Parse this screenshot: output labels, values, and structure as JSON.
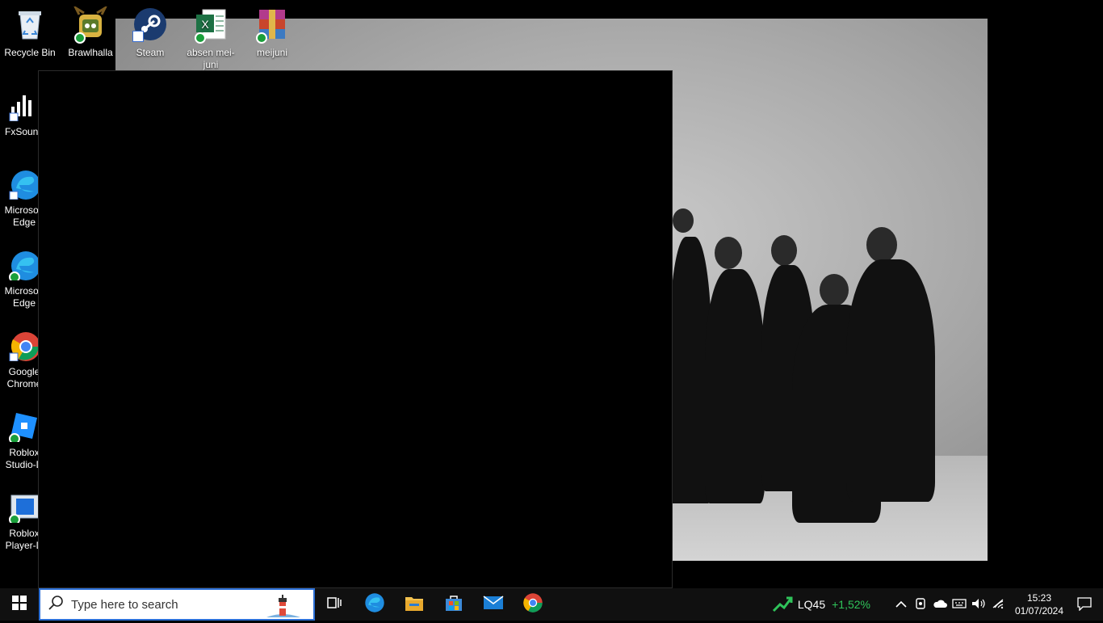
{
  "desktop": {
    "top_icons": [
      {
        "label": "Recycle Bin",
        "icon": "recycle-bin-icon"
      },
      {
        "label": "Brawlhalla",
        "icon": "brawlhalla-icon"
      },
      {
        "label": "Steam",
        "icon": "steam-icon"
      },
      {
        "label": "absen mei-juni",
        "icon": "excel-icon"
      },
      {
        "label": "meijuni",
        "icon": "winrar-icon"
      }
    ],
    "left_icons": [
      {
        "label": "FxSound",
        "icon": "fxsound-icon"
      },
      {
        "label": "Microsoft Edge",
        "icon": "edge-icon"
      },
      {
        "label": "Microsoft Edge",
        "icon": "edge-icon"
      },
      {
        "label": "Google Chrome",
        "icon": "chrome-icon"
      },
      {
        "label": "Roblox Studio-D",
        "icon": "roblox-studio-icon"
      },
      {
        "label": "Roblox Player-D",
        "icon": "roblox-player-icon"
      }
    ]
  },
  "taskbar": {
    "search_placeholder": "Type here to search",
    "pinned": [
      "task-view-icon",
      "edge-icon",
      "file-explorer-icon",
      "microsoft-store-icon",
      "mail-icon",
      "chrome-icon"
    ],
    "stock": {
      "name": "LQ45",
      "change": "+1,52%"
    },
    "clock": {
      "time": "15:23",
      "date": "01/07/2024"
    }
  },
  "colors": {
    "taskbar": "#101010",
    "search_border": "#2b6fd6",
    "stock_up": "#2fc35a"
  }
}
